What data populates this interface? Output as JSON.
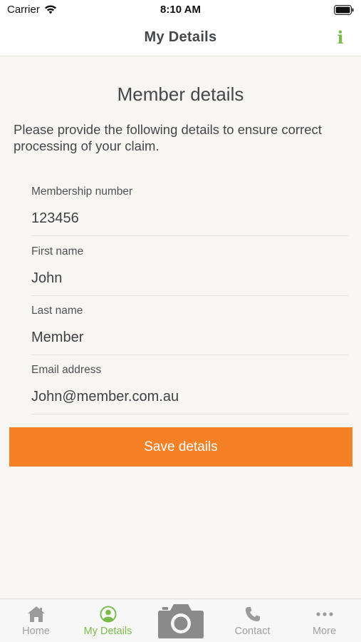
{
  "status_bar": {
    "carrier": "Carrier",
    "time": "8:10 AM"
  },
  "nav": {
    "title": "My Details",
    "info_glyph": "i",
    "accent_color": "#7bbb4e"
  },
  "main": {
    "heading": "Member details",
    "intro": "Please provide the following details to ensure correct processing of your claim.",
    "fields": [
      {
        "label": "Membership number",
        "value": "123456"
      },
      {
        "label": "First name",
        "value": "John"
      },
      {
        "label": "Last name",
        "value": "Member"
      },
      {
        "label": "Email address",
        "value": "John@member.com.au"
      }
    ],
    "save_label": "Save details",
    "save_color": "#f58025"
  },
  "tabs": [
    {
      "label": "Home",
      "icon": "home-icon",
      "active": false
    },
    {
      "label": "My Details",
      "icon": "user-circle-icon",
      "active": true
    },
    {
      "label": "",
      "icon": "camera-icon",
      "active": false
    },
    {
      "label": "Contact",
      "icon": "phone-icon",
      "active": false
    },
    {
      "label": "More",
      "icon": "more-dots-icon",
      "active": false
    }
  ]
}
